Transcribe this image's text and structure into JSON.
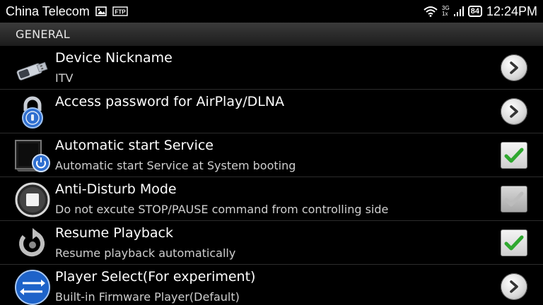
{
  "status_bar": {
    "carrier": "China Telecom",
    "net_top": "3G",
    "net_bottom": "1x",
    "battery": "84",
    "time": "12:24PM",
    "icons": [
      "image-icon",
      "ftp-icon",
      "wifi-icon",
      "signal-icon",
      "battery-icon"
    ],
    "ftp_label": "FTP"
  },
  "section": {
    "title": "GENERAL"
  },
  "settings": [
    {
      "title": "Device Nickname",
      "summary": "ITV",
      "icon": "usb-dongle-icon",
      "widget": "chevron",
      "checked": false,
      "enabled": true
    },
    {
      "title": "Access password for AirPlay/DLNA",
      "summary": "",
      "icon": "padlock-icon",
      "widget": "chevron",
      "checked": false,
      "enabled": true
    },
    {
      "title": "Automatic start Service",
      "summary": "Automatic start Service at System booting",
      "icon": "monitor-power-icon",
      "widget": "checkbox",
      "checked": true,
      "enabled": true
    },
    {
      "title": "Anti-Disturb Mode",
      "summary": "Do not excute STOP/PAUSE command from controlling side",
      "icon": "stop-button-icon",
      "widget": "checkbox",
      "checked": true,
      "enabled": false
    },
    {
      "title": "Resume Playback",
      "summary": "Resume playback automatically",
      "icon": "resume-arrow-icon",
      "widget": "checkbox",
      "checked": true,
      "enabled": true
    },
    {
      "title": "Player Select(For experiment)",
      "summary": "Built-in Firmware Player(Default)",
      "icon": "swap-arrows-icon",
      "widget": "chevron",
      "checked": false,
      "enabled": true
    }
  ],
  "colors": {
    "check_green": "#2fa82f",
    "check_disabled": "#bcbcbc",
    "header_bg": "#2a2a2a"
  }
}
